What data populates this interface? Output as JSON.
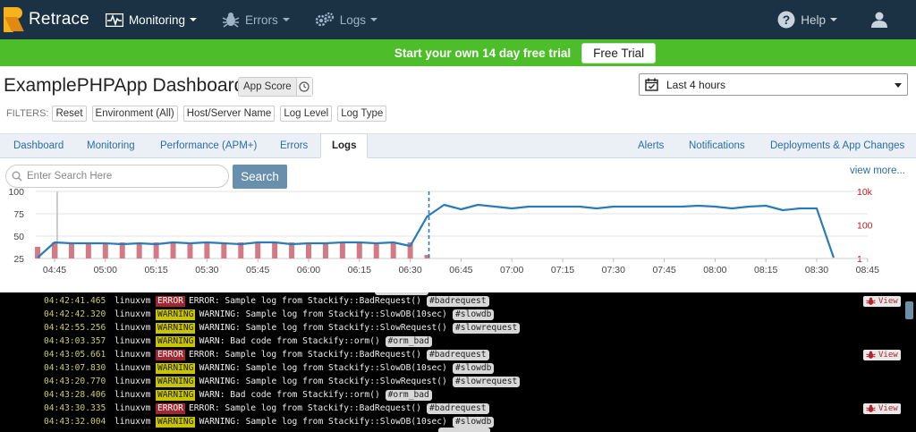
{
  "brand": {
    "name": "Retrace",
    "accent": "#f7b31b"
  },
  "nav": {
    "items": [
      {
        "label": "Monitoring",
        "icon": "pulse-icon"
      },
      {
        "label": "Errors",
        "icon": "bug-icon"
      },
      {
        "label": "Logs",
        "icon": "gears-icon"
      }
    ],
    "help_label": "Help",
    "user_icon": "user-icon"
  },
  "banner": {
    "text": "Start your own 14 day free trial",
    "button": "Free Trial",
    "color": "#4dbd2a"
  },
  "page": {
    "title": "ExamplePHPApp Dashboard",
    "app_score_label": "App Score",
    "time_range": "Last 4 hours"
  },
  "filters": {
    "label": "FILTERS:",
    "chips": [
      "Reset",
      "Environment (All)",
      "Host/Server Name",
      "Log Level",
      "Log Type"
    ]
  },
  "tabs": {
    "left": [
      "Dashboard",
      "Monitoring",
      "Performance (APM+)",
      "Errors",
      "Logs"
    ],
    "active": "Logs",
    "right": [
      "Alerts",
      "Notifications",
      "Deployments & App Changes"
    ]
  },
  "search": {
    "placeholder": "Enter Search Here",
    "button": "Search",
    "view_more": "view more..."
  },
  "chart_data": {
    "type": "line",
    "x_ticks": [
      "04:45",
      "05:00",
      "05:15",
      "05:30",
      "05:45",
      "06:00",
      "06:15",
      "06:30",
      "06:45",
      "07:00",
      "07:15",
      "07:30",
      "07:45",
      "08:00",
      "08:15",
      "08:30",
      "08:45"
    ],
    "left_axis_ticks": [
      "100",
      "75",
      "50",
      "25"
    ],
    "right_axis_ticks": [
      "10k",
      "100",
      "1"
    ],
    "ylim": [
      25,
      100
    ],
    "series": [
      {
        "type": "line",
        "color": "#2b7bb9",
        "x": [
          "04:40",
          "04:45",
          "04:50",
          "04:55",
          "05:00",
          "05:05",
          "05:10",
          "05:15",
          "05:20",
          "05:25",
          "05:30",
          "05:35",
          "05:40",
          "05:45",
          "05:50",
          "05:55",
          "06:00",
          "06:05",
          "06:10",
          "06:15",
          "06:20",
          "06:25",
          "06:30",
          "06:35",
          "06:40",
          "06:45",
          "06:50",
          "06:55",
          "07:00",
          "07:05",
          "07:10",
          "07:15",
          "07:20",
          "07:25",
          "07:30",
          "07:35",
          "07:40",
          "07:45",
          "07:50",
          "07:55",
          "08:00",
          "08:05",
          "08:10",
          "08:15",
          "08:20",
          "08:25",
          "08:30",
          "08:35",
          "08:40"
        ],
        "y": [
          26,
          43,
          42,
          42,
          42,
          41,
          42,
          41,
          43,
          42,
          43,
          42,
          41,
          43,
          43,
          41,
          42,
          42,
          43,
          43,
          42,
          43,
          39,
          72,
          85,
          80,
          85,
          83,
          81,
          83,
          83,
          83,
          83,
          81,
          83,
          83,
          83,
          83,
          83,
          84,
          83,
          81,
          83,
          84,
          79,
          81,
          81,
          26,
          null
        ]
      },
      {
        "type": "bar",
        "color": "#d47a85",
        "x": [
          "04:40",
          "04:45",
          "04:50",
          "04:55",
          "05:00",
          "05:05",
          "05:10",
          "05:15",
          "05:20",
          "05:25",
          "05:30",
          "05:35",
          "05:40",
          "05:45",
          "05:50",
          "05:55",
          "06:00",
          "06:05",
          "06:10",
          "06:15",
          "06:20",
          "06:25",
          "06:30",
          "06:35"
        ],
        "y": [
          38,
          43,
          43,
          43,
          43,
          43,
          43,
          43,
          43,
          43,
          43,
          43,
          43,
          43,
          43,
          43,
          43,
          43,
          43,
          43,
          43,
          43,
          43,
          29
        ]
      }
    ],
    "deploy_marker": "06:35"
  },
  "logs": {
    "host": "linuxvm",
    "view_label": "View",
    "rows": [
      {
        "time": "04:42:41.465",
        "level": "ERROR",
        "message": "ERROR: Sample log from Stackify::BadRequest()",
        "tag": "#badrequest",
        "view": true
      },
      {
        "time": "04:42:42.320",
        "level": "WARNING",
        "message": "WARNING: Sample log from Stackify::SlowDB(10sec)",
        "tag": "#slowdb",
        "view": false
      },
      {
        "time": "04:42:55.256",
        "level": "WARNING",
        "message": "WARNING: Sample log from Stackify::SlowRequest()",
        "tag": "#slowrequest",
        "view": false
      },
      {
        "time": "04:43:03.357",
        "level": "WARNING",
        "message": "WARN: Bad code from Stackify::orm()",
        "tag": "#orm_bad",
        "view": false
      },
      {
        "time": "04:43:05.661",
        "level": "ERROR",
        "message": "ERROR: Sample log from Stackify::BadRequest()",
        "tag": "#badrequest",
        "view": true
      },
      {
        "time": "04:43:07.830",
        "level": "WARNING",
        "message": "WARNING: Sample log from Stackify::SlowDB(10sec)",
        "tag": "#slowdb",
        "view": false
      },
      {
        "time": "04:43:20.770",
        "level": "WARNING",
        "message": "WARNING: Sample log from Stackify::SlowRequest()",
        "tag": "#slowrequest",
        "view": false
      },
      {
        "time": "04:43:28.406",
        "level": "WARNING",
        "message": "WARN: Bad code from Stackify::orm()",
        "tag": "#orm_bad",
        "view": false
      },
      {
        "time": "04:43:30.335",
        "level": "ERROR",
        "message": "ERROR: Sample log from Stackify::BadRequest()",
        "tag": "#badrequest",
        "view": true
      },
      {
        "time": "04:43:32.004",
        "level": "WARNING",
        "message": "WARNING: Sample log from Stackify::SlowDB(10sec)",
        "tag": "#slowdb",
        "view": false
      }
    ]
  }
}
